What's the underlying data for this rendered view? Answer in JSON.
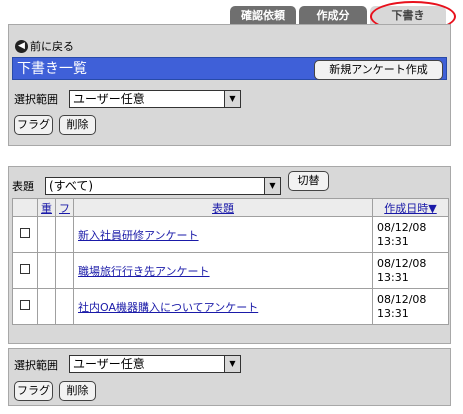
{
  "tabs": [
    {
      "label": "確認依頼"
    },
    {
      "label": "作成分"
    },
    {
      "label": "下書き"
    }
  ],
  "nav": {
    "back_label": "前に戻る"
  },
  "section": {
    "title": "下書き一覧",
    "new_button": "新規アンケート作成"
  },
  "top_filter": {
    "label": "選択範囲",
    "value": "ユーザー任意",
    "flag_button": "フラグ",
    "delete_button": "削除"
  },
  "list_filter": {
    "label": "表題",
    "value": "(すべて)",
    "switch_button": "切替"
  },
  "table": {
    "headers": {
      "priority": "重",
      "flag": "フ",
      "title": "表題",
      "date": "作成日時▼"
    },
    "rows": [
      {
        "title": "新入社員研修アンケート",
        "date": "08/12/08",
        "time": "13:31"
      },
      {
        "title": "職場旅行行き先アンケート",
        "date": "08/12/08",
        "time": "13:31"
      },
      {
        "title": "社内OA機器購入についてアンケート",
        "date": "08/12/08",
        "time": "13:31"
      }
    ]
  },
  "bottom_filter": {
    "label": "選択範囲",
    "value": "ユーザー任意",
    "flag_button": "フラグ",
    "delete_button": "削除"
  },
  "colors": {
    "title_bar": "#3f60d8",
    "active_tab_ring": "#e8101c",
    "link": "#1a1aa8"
  }
}
